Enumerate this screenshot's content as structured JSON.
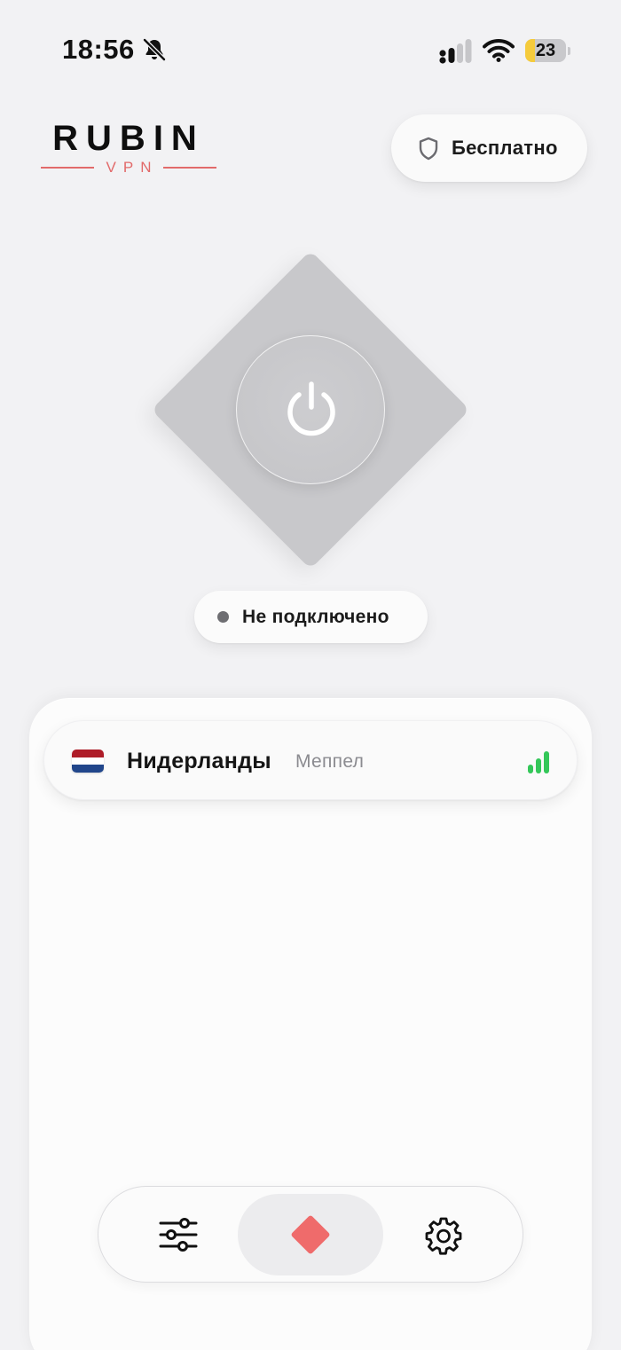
{
  "status_bar": {
    "time": "18:56",
    "battery_level": "23",
    "battery_fraction": 0.23,
    "icons": [
      "bell-muted-icon",
      "cellular-icon",
      "wifi-icon",
      "battery-icon"
    ]
  },
  "logo": {
    "word": "RUBIN",
    "sub": "VPN",
    "accent_color": "#e26a6a"
  },
  "plan": {
    "label": "Бесплатно",
    "icon": "shield-icon"
  },
  "connect": {
    "icon": "power-icon",
    "diamond_color": "#c8c8cb"
  },
  "connection_status": {
    "text": "Не подключено",
    "dot_color": "#6e6e72"
  },
  "server": {
    "flag": "netherlands-flag",
    "flag_colors": [
      "#ae1c28",
      "#ffffff",
      "#21468b"
    ],
    "country": "Нидерланды",
    "city": "Меппел",
    "signal_icon": "signal-strength-icon",
    "signal_bars_active": 3,
    "signal_color": "#34c759"
  },
  "nav": {
    "items": [
      {
        "name": "filters",
        "icon": "sliders-icon"
      },
      {
        "name": "home",
        "icon": "diamond-icon",
        "active": true,
        "color": "#ef6b6b"
      },
      {
        "name": "settings",
        "icon": "gear-icon"
      }
    ]
  }
}
